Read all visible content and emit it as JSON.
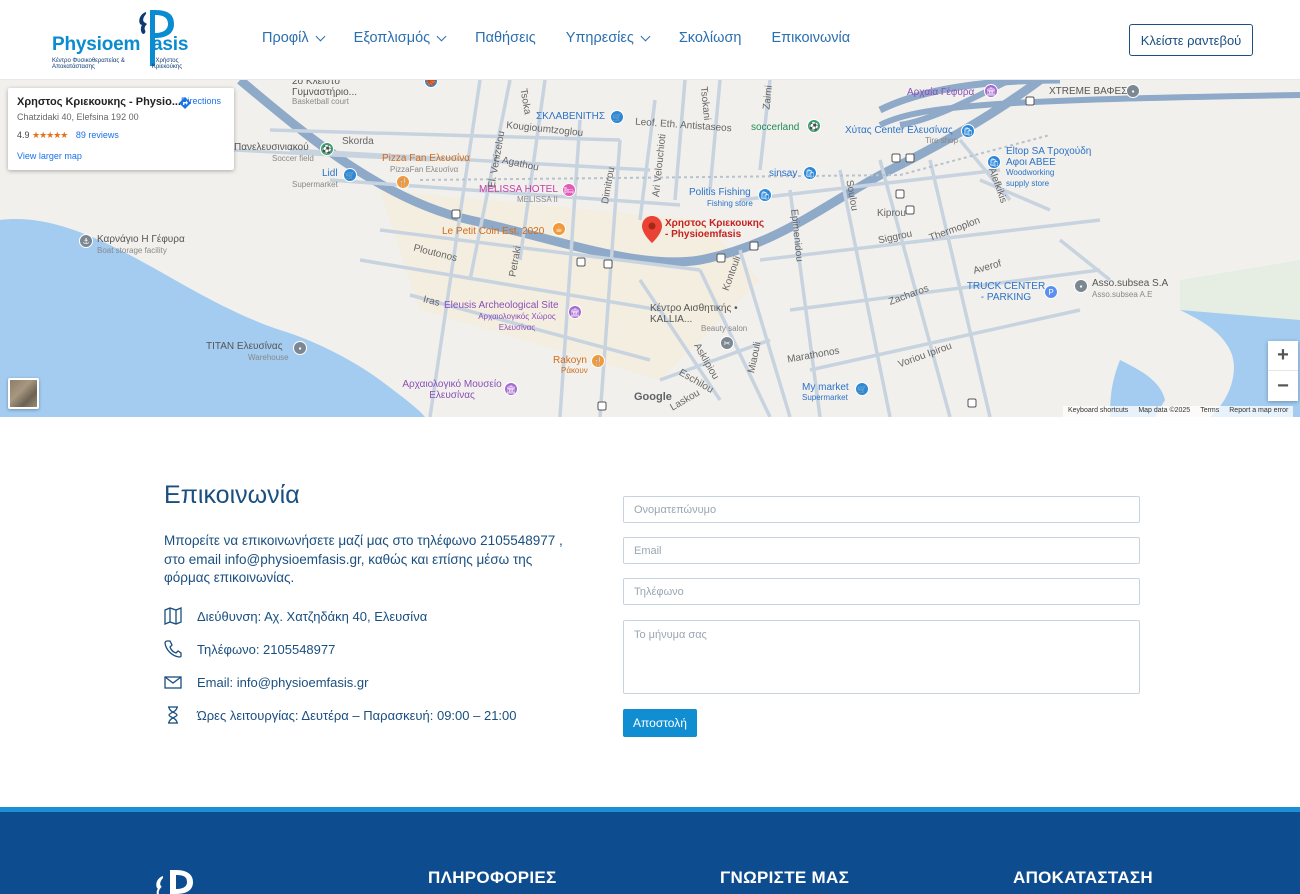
{
  "header": {
    "logo": {
      "brand": "Physioem Pasis",
      "tagline_left": "Κέντρο Φυσικοθεραπείας & Αποκατάστασης",
      "tagline_right": "Χρήστος Κριεκούκης"
    },
    "nav": [
      {
        "label": "Προφίλ",
        "has_dropdown": true
      },
      {
        "label": "Εξοπλισμός",
        "has_dropdown": true
      },
      {
        "label": "Παθήσεις",
        "has_dropdown": false
      },
      {
        "label": "Υπηρεσίες",
        "has_dropdown": true
      },
      {
        "label": "Σκολίωση",
        "has_dropdown": false
      },
      {
        "label": "Επικοινωνία",
        "has_dropdown": false
      }
    ],
    "cta_label": "Κλείστε ραντεβού"
  },
  "map": {
    "card": {
      "title": "Χρηστος Κριεκουκης - Physio...",
      "address": "Chatzidaki 40, Elefsina 192 00",
      "rating": "4.9",
      "stars": "★★★★★",
      "reviews": "89 reviews",
      "larger_map": "View larger map",
      "directions": "Directions"
    },
    "labels": {
      "gym": "2ο Κλειστό Γυμναστήριο...",
      "gym_sub": "Basketball court",
      "panelefs": "Πανελευσινιακού",
      "panelefs_sub": "Soccer field",
      "lidl": "Lidl",
      "lidl_sub": "Supermarket",
      "pizza": "Pizza Fan Ελευσίνα",
      "pizza_sub": "PizzaFan Ελευσίνα",
      "melissa": "MELISSA HOTEL",
      "melissa_sub": "MELISSA II",
      "petit": "Le Petit Coin Est. 2020",
      "karnagio": "Καρνάγιο Η Γέφυρα",
      "karnagio_sub": "Boat storage facility",
      "eleusis": "Eleusis Archeological Site",
      "eleusis_sub": "Αρχαιολογικός Χώρος Ελευσίνας",
      "rakoyn": "Rakoyn",
      "rakoyn_sub": "Ράκουν",
      "titan": "TITAN Ελευσίνας",
      "titan_sub": "Warehouse",
      "museum": "Αρχαιολογικό Μουσείο Ελευσίνας",
      "sklav": "ΣΚΛΑΒΕΝΙΤΗΣ",
      "soccerland": "soccerland",
      "politis": "Politis Fishing",
      "politis_sub": "Fishing store",
      "pin": "Χρηστος Κριεκουκης - Physioemfasis",
      "sinsay": "sinsay",
      "hytas": "Χύτας Center Ελευσίνας",
      "hytas_sub": "Tire shop",
      "eltop": "Eltop SA Τροχούδη Αφοι ΑΒΕΕ",
      "eltop_sub": "Woodworking supply store",
      "gefyra": "Αρχαία Γέφυρα",
      "xtreme": "XTREME ΒΑΦΕΣ",
      "kallia": "Κέντρο Αισθητικής • KALLIA...",
      "kallia_sub": "Beauty salon",
      "truck": "TRUCK CENTER - PARKING",
      "asso": "Asso.subsea S.A",
      "asso_sub": "Asso.subsea A.E",
      "mymarket": "My market",
      "mymarket_sub": "Supermarket",
      "streets": [
        "Skorda",
        "Kougioumtzoglou",
        "Leof. Eth. Antistaseos",
        "I. Agathou",
        "Dimitrou",
        "Ari Velouchioti",
        "Epimenidou",
        "Nikou Nezi",
        "Kiprou",
        "Siggrou",
        "Thermoplon",
        "Averof",
        "Zacharos",
        "Oceanidon",
        "Voriou Ipirou",
        "Marathonos",
        "Asklipiou",
        "Eschilou",
        "Laskou",
        "Kontouli",
        "Miaouli",
        "Ploutonos",
        "Iras",
        "Petraki",
        "El. Venizelou",
        "Tsoka",
        "Tsokani",
        "Zaimi",
        "Ermou",
        "Soulou",
        "Kanellopoulou",
        "Alefkikis"
      ]
    },
    "google": "Google",
    "footer": [
      "Keyboard shortcuts",
      "Map data ©2025",
      "Terms",
      "Report a map error"
    ]
  },
  "contact": {
    "title": "Επικοινωνία",
    "text": "Μπορείτε να επικοινωνήσετε μαζί μας στο τηλέφωνο 2105548977 , στο email info@physioemfasis.gr, καθώς και επίσης μέσω της φόρμας επικοινωνίας.",
    "address": "Διεύθυνση: Αχ. Χατζηδάκη 40, Ελευσίνα",
    "phone": "Τηλέφωνο: 2105548977",
    "email": "Email: info@physioemfasis.gr",
    "hours": "Ώρες λειτουργίας: Δευτέρα – Παρασκευή: 09:00 – 21:00"
  },
  "form": {
    "name_placeholder": "Ονοματεπώνυμο",
    "email_placeholder": "Email",
    "phone_placeholder": "Τηλέφωνο",
    "message_placeholder": "Το μήνυμα σας",
    "submit_label": "Αποστολή"
  },
  "footer": {
    "headings": [
      "ΠΛΗΡΟΦΟΡΙΕΣ",
      "ΓΝΩΡΙΣΤΕ ΜΑΣ",
      "ΑΠΟΚΑΤΑΣΤΑΣΗ"
    ]
  },
  "colors": {
    "brand_blue": "#1a4f80",
    "accent": "#118ed2",
    "footer_bg": "#0d4d8f"
  }
}
